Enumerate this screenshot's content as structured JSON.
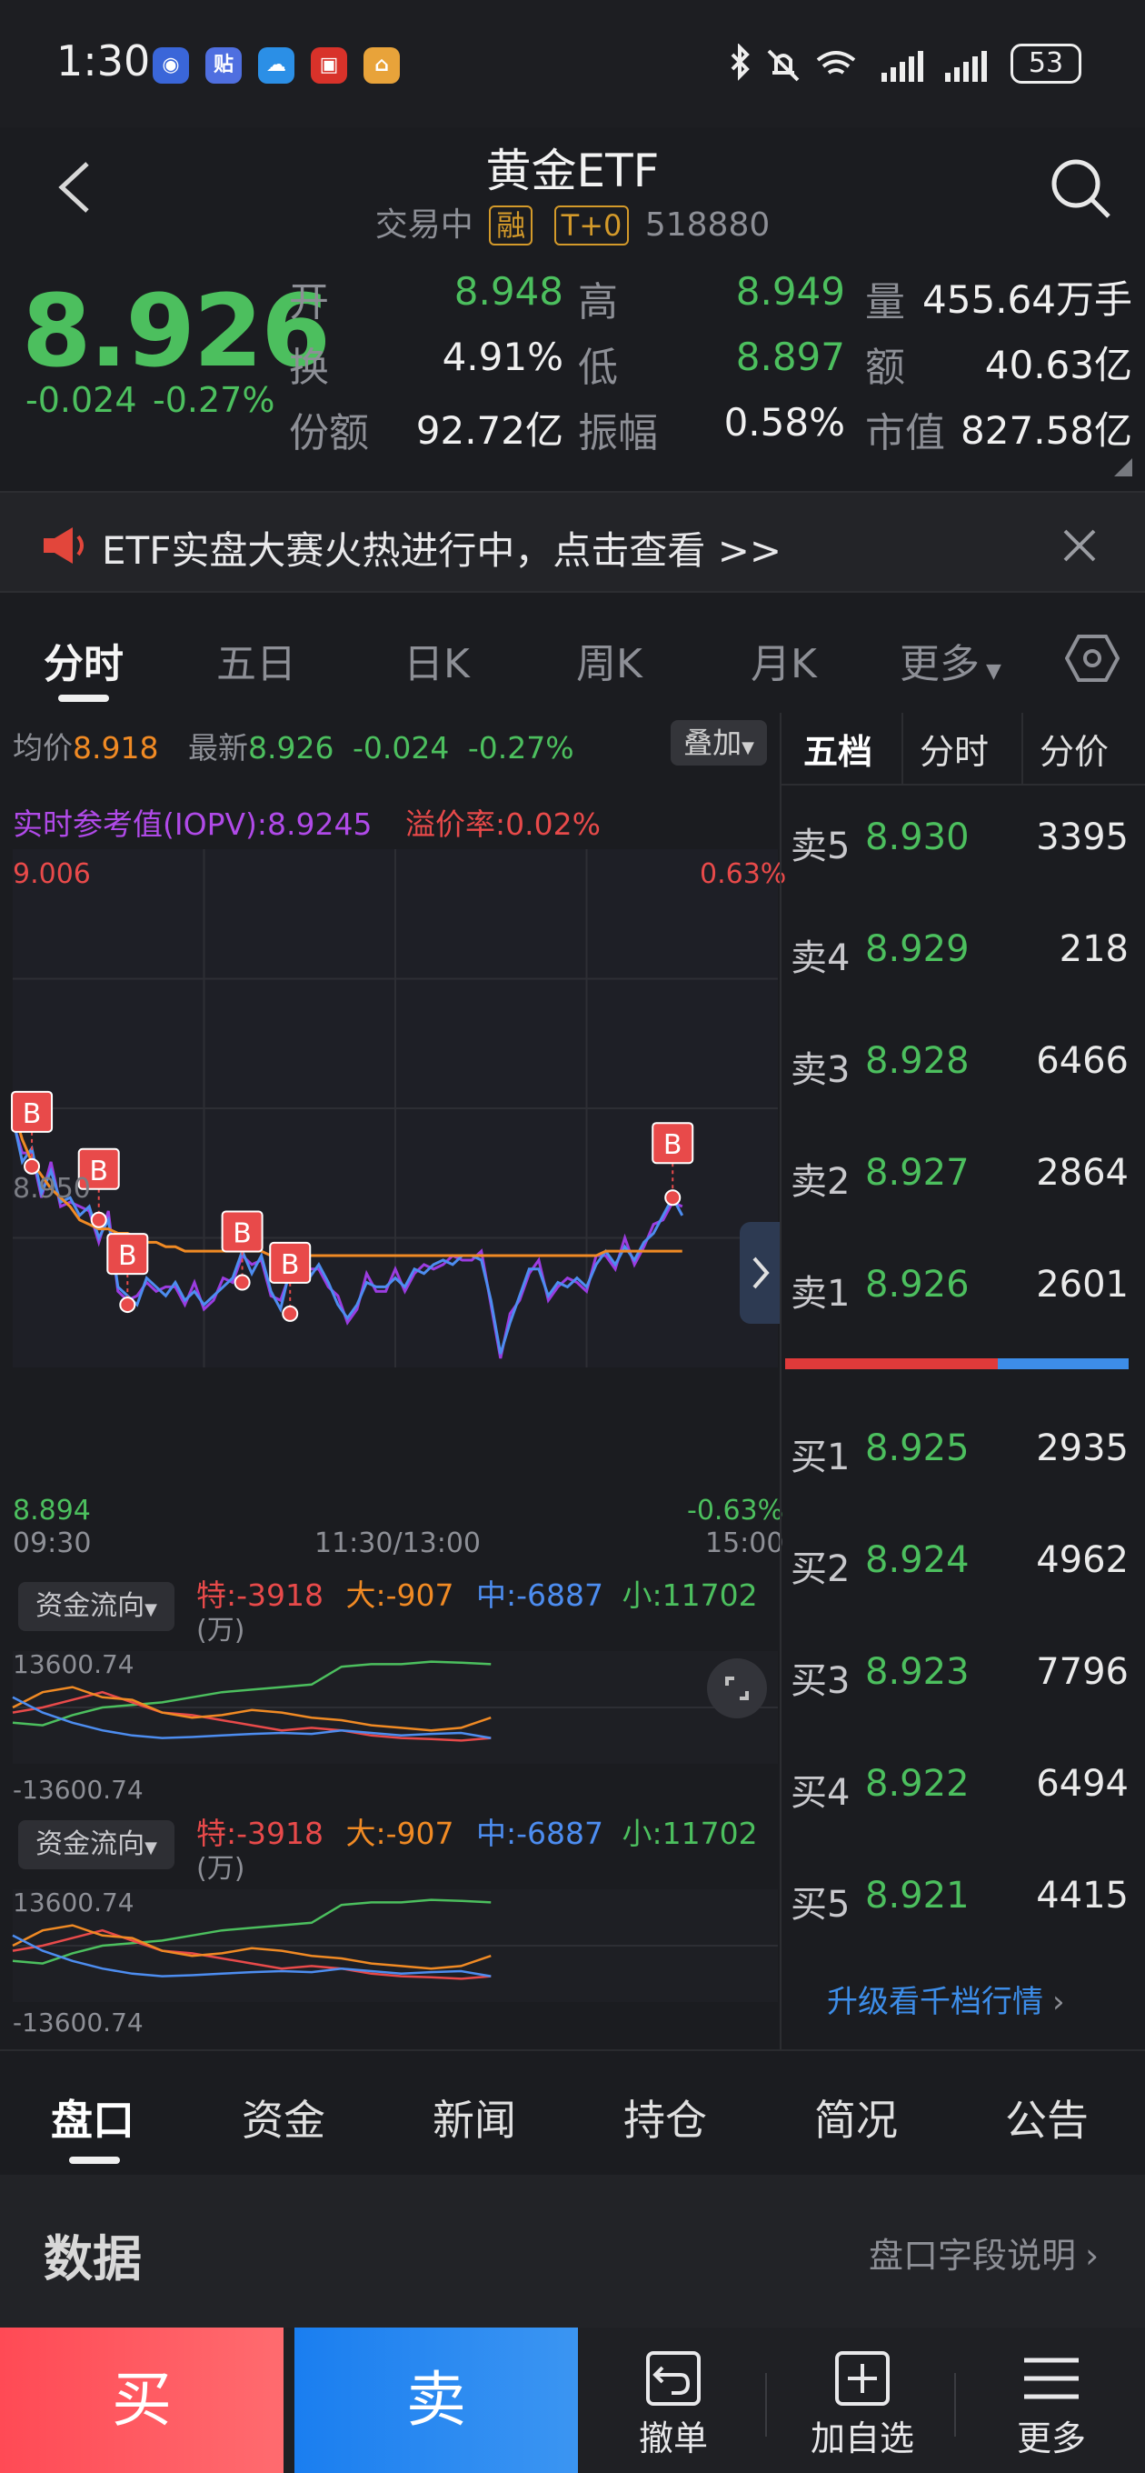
{
  "status_bar": {
    "time": "1:30",
    "app_icons": [
      "baidu-app-icon",
      "tieba-app-icon",
      "cloud-app-icon",
      "shopping-app-icon",
      "home-app-icon"
    ],
    "battery": "53"
  },
  "header": {
    "title": "黄金ETF",
    "status": "交易中",
    "tag_margin": "融",
    "tag_t0": "T+0",
    "code": "518880"
  },
  "quote": {
    "price": "8.926",
    "change": "-0.024",
    "change_pct": "-0.27%",
    "stats": [
      {
        "label": "开",
        "value": "8.948",
        "color": "#4cbf5e"
      },
      {
        "label": "高",
        "value": "8.949",
        "color": "#4cbf5e"
      },
      {
        "label": "量",
        "value": "455.64万手",
        "color": "#f0f0f0"
      },
      {
        "label": "换",
        "value": "4.91%",
        "color": "#f0f0f0"
      },
      {
        "label": "低",
        "value": "8.897",
        "color": "#4cbf5e"
      },
      {
        "label": "额",
        "value": "40.63亿",
        "color": "#f0f0f0"
      },
      {
        "label": "份额",
        "value": "92.72亿",
        "color": "#f0f0f0"
      },
      {
        "label": "振幅",
        "value": "0.58%",
        "color": "#f0f0f0"
      },
      {
        "label": "市值",
        "value": "827.58亿",
        "color": "#f0f0f0"
      }
    ]
  },
  "banner": {
    "text": "ETF实盘大赛火热进行中，点击查看 >>"
  },
  "tabs": [
    "分时",
    "五日",
    "日K",
    "周K",
    "月K",
    "更多"
  ],
  "chart_info": {
    "avg_label": "均价",
    "avg_value": "8.918",
    "latest_label": "最新",
    "latest_value": "8.926",
    "latest_change": "-0.024",
    "latest_pct": "-0.27%",
    "overlay_btn": "叠加",
    "iopv": "实时参考值(IOPV):8.9245",
    "premium_label": "溢价率:",
    "premium_value": "0.02%",
    "y_top": "9.006",
    "y_mid": "8.950",
    "y_bottom": "8.894",
    "pct_top": "0.63%",
    "pct_bottom": "-0.63%",
    "x_start": "09:30",
    "x_mid": "11:30/13:00",
    "x_end": "15:00",
    "b_marker": "B"
  },
  "chart_data": {
    "type": "line",
    "x": [
      0,
      3,
      6,
      9,
      12,
      15,
      18,
      21,
      24,
      27,
      30,
      33,
      36,
      39,
      42,
      45,
      48,
      51,
      54,
      57,
      60,
      63,
      66,
      69,
      72,
      75,
      78,
      81,
      84,
      87,
      90,
      93,
      96,
      99,
      102,
      105,
      108,
      111,
      114,
      117,
      120,
      123,
      126,
      129,
      132,
      135,
      138,
      141,
      144,
      147,
      150,
      153,
      156,
      159,
      162,
      165,
      168,
      171,
      174,
      177,
      180,
      183,
      186,
      189,
      192,
      195,
      198,
      201,
      204,
      207,
      210
    ],
    "series": [
      {
        "values": [
          8.948,
          8.938,
          8.941,
          8.931,
          8.936,
          8.929,
          8.93,
          8.926,
          8.928,
          8.921,
          8.925,
          8.91,
          8.908,
          8.906,
          8.912,
          8.91,
          8.908,
          8.911,
          8.907,
          8.909,
          8.906,
          8.908,
          8.91,
          8.912,
          8.918,
          8.913,
          8.917,
          8.909,
          8.905,
          8.914,
          8.913,
          8.912,
          8.915,
          8.911,
          8.906,
          8.903,
          8.906,
          8.911,
          8.91,
          8.91,
          8.912,
          8.91,
          8.914,
          8.913,
          8.915,
          8.916,
          8.915,
          8.917,
          8.917,
          8.916,
          8.907,
          8.895,
          8.902,
          8.908,
          8.914,
          8.914,
          8.908,
          8.911,
          8.91,
          8.912,
          8.91,
          8.915,
          8.918,
          8.915,
          8.919,
          8.916,
          8.92,
          8.922,
          8.926,
          8.93,
          8.926
        ],
        "color": "#4d8df0"
      },
      {
        "values": [
          8.95,
          8.943,
          8.938,
          8.935,
          8.932,
          8.93,
          8.928,
          8.925,
          8.924,
          8.923,
          8.923,
          8.922,
          8.922,
          8.921,
          8.92,
          8.92,
          8.919,
          8.919,
          8.918,
          8.918,
          8.918,
          8.918,
          8.918,
          8.918,
          8.918,
          8.918,
          8.918,
          8.917,
          8.917,
          8.917,
          8.917,
          8.917,
          8.917,
          8.917,
          8.917,
          8.917,
          8.917,
          8.917,
          8.917,
          8.917,
          8.917,
          8.917,
          8.917,
          8.917,
          8.917,
          8.917,
          8.917,
          8.917,
          8.917,
          8.917,
          8.917,
          8.917,
          8.917,
          8.917,
          8.917,
          8.917,
          8.917,
          8.917,
          8.917,
          8.917,
          8.917,
          8.917,
          8.918,
          8.918,
          8.918,
          8.918,
          8.918,
          8.918,
          8.918,
          8.918,
          8.918
        ],
        "color": "#f08a24"
      }
    ],
    "ylim": [
      8.894,
      9.006
    ]
  },
  "order_book": {
    "tabs": [
      "五档",
      "分时",
      "分价"
    ],
    "asks": [
      {
        "label": "卖5",
        "price": "8.930",
        "volume": "3395"
      },
      {
        "label": "卖4",
        "price": "8.929",
        "volume": "218"
      },
      {
        "label": "卖3",
        "price": "8.928",
        "volume": "6466"
      },
      {
        "label": "卖2",
        "price": "8.927",
        "volume": "2864"
      },
      {
        "label": "卖1",
        "price": "8.926",
        "volume": "2601"
      }
    ],
    "bids": [
      {
        "label": "买1",
        "price": "8.925",
        "volume": "2935"
      },
      {
        "label": "买2",
        "price": "8.924",
        "volume": "4962"
      },
      {
        "label": "买3",
        "price": "8.923",
        "volume": "7796"
      },
      {
        "label": "买4",
        "price": "8.922",
        "volume": "6494"
      },
      {
        "label": "买5",
        "price": "8.921",
        "volume": "4415"
      }
    ],
    "ratio_red": 0.62,
    "upgrade": "升级看千档行情"
  },
  "fund_flow": {
    "label": "资金流向",
    "unit": "(万)",
    "special": "特:-3918",
    "large": "大:-907",
    "medium": "中:-6887",
    "small": "小:11702",
    "y_top": "13600.74",
    "y_bottom": "-13600.74"
  },
  "subtabs": [
    "盘口",
    "资金",
    "新闻",
    "持仓",
    "简况",
    "公告"
  ],
  "data_section": {
    "title": "数据",
    "link": "盘口字段说明"
  },
  "actions": {
    "buy": "买",
    "sell": "卖",
    "cancel": "撤单",
    "watchlist": "加自选",
    "more": "更多"
  }
}
